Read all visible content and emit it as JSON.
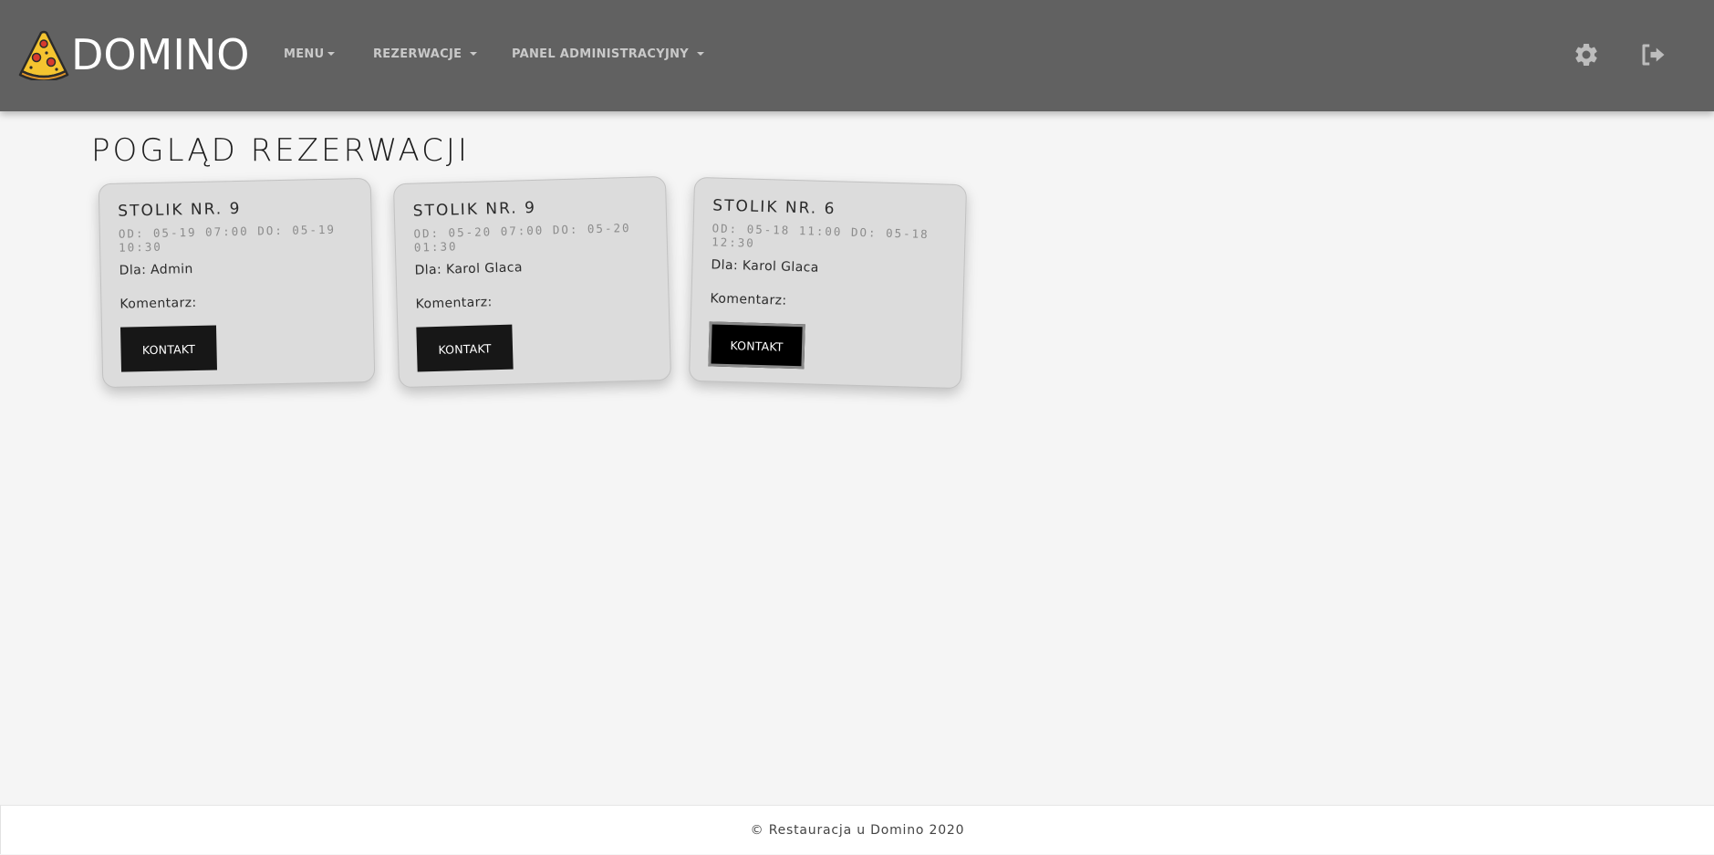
{
  "navbar": {
    "brand": {
      "logo_icon": "pizza-slice-icon",
      "text": "DOMINO"
    },
    "items": [
      {
        "label": "MENU"
      },
      {
        "label": "REZERWACJE"
      },
      {
        "label": "PANEL ADMINISTRACYJNY"
      }
    ],
    "settings_icon": "gear-icon",
    "logout_icon": "sign-out-icon",
    "background_color": "#616161",
    "item_color": "#c9c9c9"
  },
  "main": {
    "title": "POGLĄD REZERWACJI",
    "reservations": [
      {
        "table": "STOLIK NR. 9",
        "dates": "OD: 05-19 07:00 DO: 05-19 10:30",
        "for": "Dla: Admin",
        "comment": "Komentarz:",
        "button_label": "KONTAKT"
      },
      {
        "table": "STOLIK NR. 9",
        "dates": "OD: 05-20 07:00 DO: 05-20 01:30",
        "for": "Dla: Karol Glaca",
        "comment": "Komentarz:",
        "button_label": "KONTAKT"
      },
      {
        "table": "STOLIK NR. 6",
        "dates": "OD: 05-18 11:00 DO: 05-18 12:30",
        "for": "Dla: Karol Glaca",
        "comment": "Komentarz:",
        "button_label": "KONTAKT"
      }
    ],
    "card_color": "#dcdcdc",
    "button_color": "#171717"
  },
  "footer": {
    "text": "© Restauracja u Domino 2020"
  }
}
